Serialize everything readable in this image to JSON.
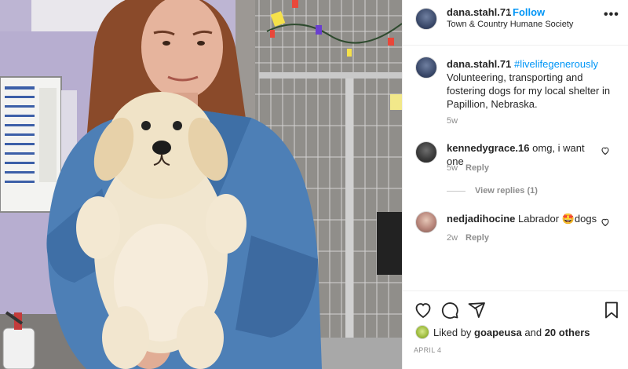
{
  "post": {
    "owner": "dana.stahl.71",
    "follow_label": "Follow",
    "separator": "•",
    "location": "Town & Country Humane Society",
    "more_label": "•••"
  },
  "caption": {
    "username": "dana.stahl.71",
    "hashtag": "#livelifegenerously",
    "text": "Volunteering, transporting and fostering dogs for my local shelter in Papillion, Nebraska.",
    "time": "5w"
  },
  "comments": [
    {
      "username": "kennedygrace.16",
      "text": "omg, i want one",
      "time": "5w",
      "reply_label": "Reply"
    },
    {
      "username": "nedjadihocine",
      "text": "Labrador",
      "emoji": "🤩",
      "text_after": "dogs",
      "time": "2w",
      "reply_label": "Reply"
    }
  ],
  "view_replies": "View replies (1)",
  "likes": {
    "prefix": "Liked by",
    "user": "goapeusa",
    "and": "and",
    "others": "20 others"
  },
  "date": "APRIL 4",
  "colors": {
    "accent": "#0095f6",
    "text": "#262626",
    "muted": "#8e8e8e"
  },
  "icons": [
    "heart-icon",
    "comment-icon",
    "share-icon",
    "bookmark-icon",
    "more-icon"
  ]
}
